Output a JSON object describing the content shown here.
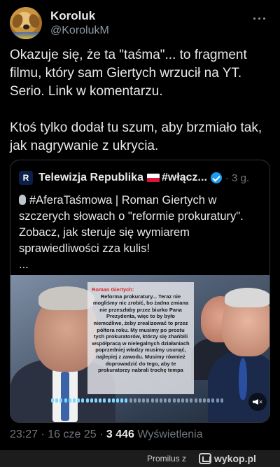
{
  "author": {
    "display_name": "Koroluk",
    "handle": "@KorolukM"
  },
  "tweet": {
    "paragraph_1": "Okazuje się, że ta \"taśma\"... to fragment filmu, który sam Giertych wrzucił na YT. Serio. Link w komentarzu.",
    "paragraph_2": "Ktoś tylko dodał tu szum, aby brzmiało tak, jak nagrywanie z ukrycia."
  },
  "quoted": {
    "logo_letter": "R",
    "name": "Telewizja Republika",
    "name_suffix": "#włącz...",
    "time": "· 3 g.",
    "text_line_1": "#AferaTaśmowa | Roman Giertych w szczerych słowach o \"reformie prokuratury\". Zobacz, jak steruje się wymiarem sprawiedliwości zza kulis!",
    "ellipsis": "...",
    "media_caption_speaker": "Roman Giertych:",
    "media_caption_text": "Reforma prokuratury... Teraz nie mogliśmy nic zrobić, bo żadna zmiana nie przeszłaby przez biurko Pana Prezydenta, więc to by było niemożliwe, żeby zrealizować to przez półtora roku. My musimy po prostu tych prokuratorów, którzy się zhańbili współpracą w nielegalnych działaniach poprzedniej władzy musimy usunąć, najlepiej z zawodu. Musimy również doprowadzić do tego, aby te prokuratorzy nabrali trochę tempa"
  },
  "meta": {
    "time_date": "23:27 · 16 cze 25 ·",
    "views_count": "3 446",
    "views_label": "Wyświetlenia"
  },
  "footer": {
    "user": "Promilus",
    "separator": "z",
    "site": "wykop.pl"
  },
  "colors": {
    "background": "#000000",
    "text": "#e7e9ea",
    "muted": "#71767b",
    "verified": "#1d9bf0",
    "border": "#2f3336"
  }
}
